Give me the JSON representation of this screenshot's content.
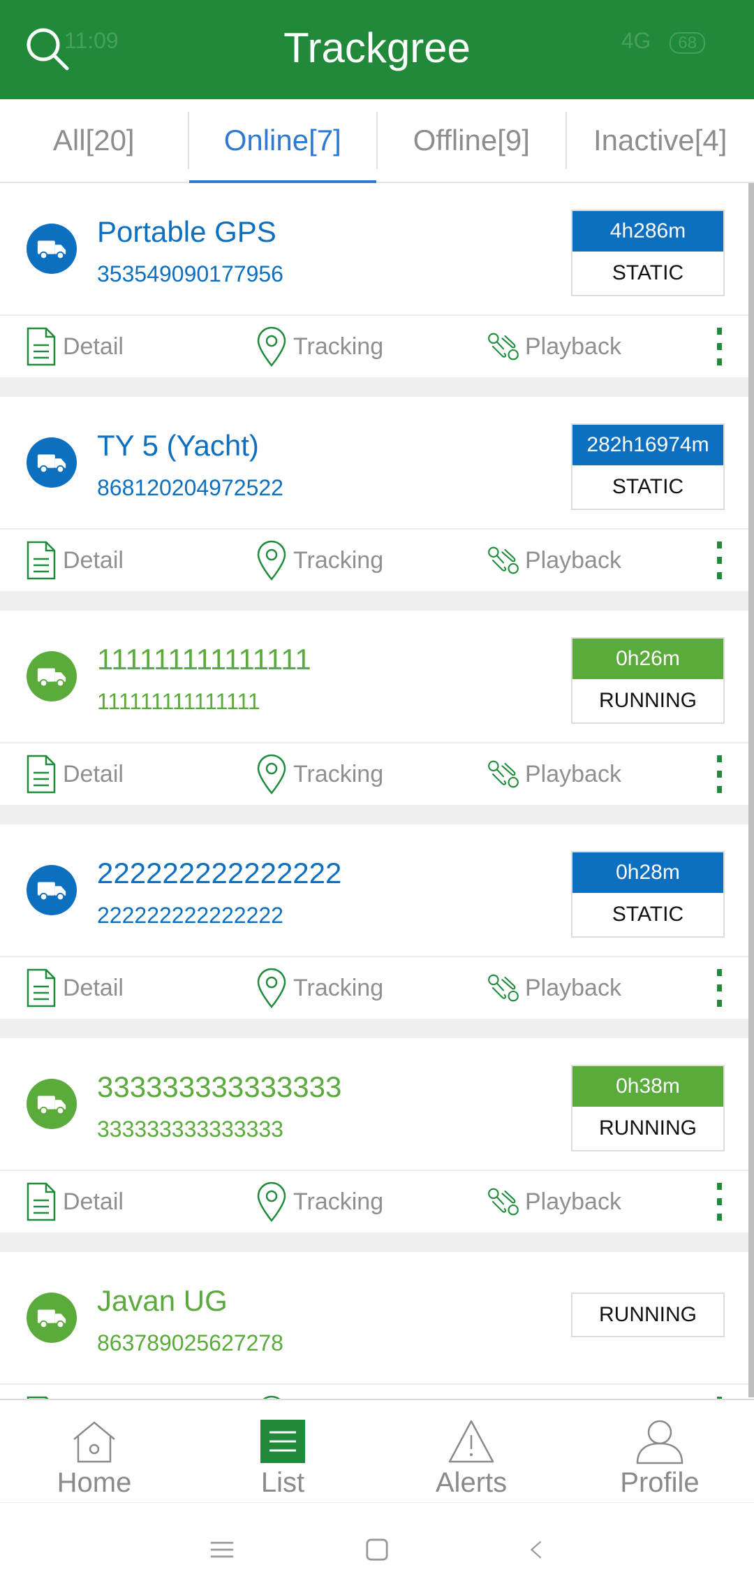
{
  "status_bar": {
    "time": "11:09",
    "network": "4G",
    "battery": "68"
  },
  "header": {
    "title": "Trackgree"
  },
  "tabs": [
    {
      "label": "All[20]",
      "active": false
    },
    {
      "label": "Online[7]",
      "active": true
    },
    {
      "label": "Offline[9]",
      "active": false
    },
    {
      "label": "Inactive[4]",
      "active": false
    }
  ],
  "actions": {
    "detail": "Detail",
    "tracking": "Tracking",
    "playback": "Playback"
  },
  "devices": [
    {
      "name": "Portable GPS",
      "imei": "353549090177956",
      "duration": "4h286m",
      "state": "STATIC",
      "color": "#0c6fc0"
    },
    {
      "name": "TY 5 (Yacht)",
      "imei": "868120204972522",
      "duration": "282h16974m",
      "state": "STATIC",
      "color": "#0c6fc0"
    },
    {
      "name": "111111111111111",
      "imei": "111111111111111",
      "duration": "0h26m",
      "state": "RUNNING",
      "color": "#5aaa3c"
    },
    {
      "name": "222222222222222",
      "imei": "222222222222222",
      "duration": "0h28m",
      "state": "STATIC",
      "color": "#0c6fc0"
    },
    {
      "name": "333333333333333",
      "imei": "333333333333333",
      "duration": "0h38m",
      "state": "RUNNING",
      "color": "#5aaa3c"
    },
    {
      "name": "Javan UG",
      "imei": "863789025627278",
      "duration": "",
      "state": "RUNNING",
      "color": "#5aaa3c"
    }
  ],
  "bottom_nav": [
    {
      "label": "Home",
      "icon": "home-icon",
      "active": false
    },
    {
      "label": "List",
      "icon": "list-icon",
      "active": true
    },
    {
      "label": "Alerts",
      "icon": "alert-icon",
      "active": false
    },
    {
      "label": "Profile",
      "icon": "profile-icon",
      "active": false
    }
  ],
  "colors": {
    "brand": "#208a3a",
    "static": "#0c6fc0",
    "running": "#5aaa3c",
    "tab_active": "#2e7ad2"
  }
}
